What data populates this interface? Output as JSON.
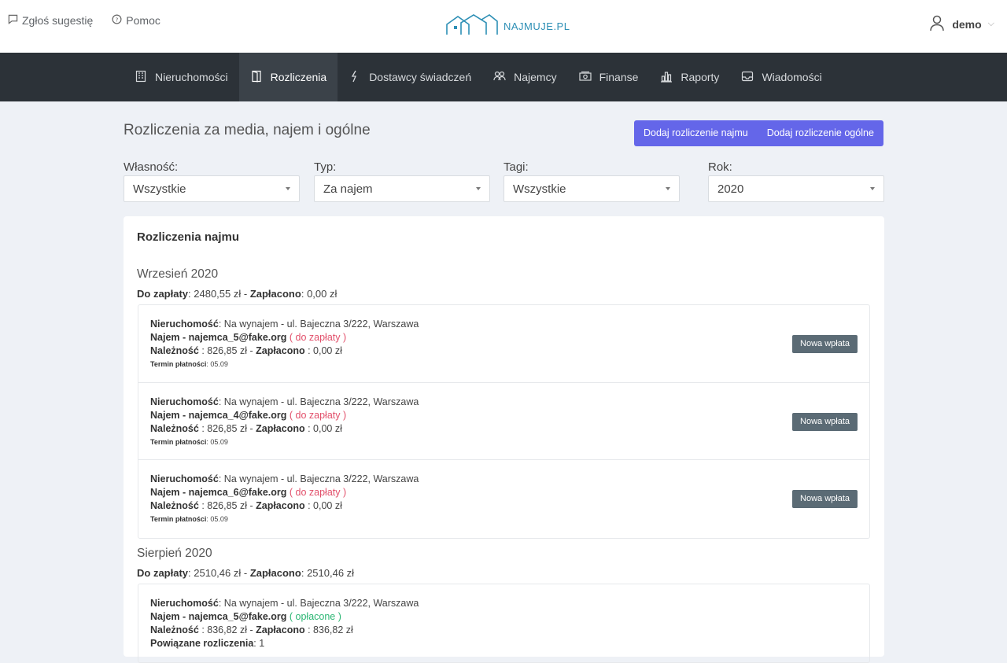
{
  "topbar": {
    "suggest_label": "Zgłoś sugestię",
    "help_label": "Pomoc",
    "logo_text": "NAJMUJE.PL",
    "user_name": "demo"
  },
  "nav": {
    "items": [
      {
        "label": "Nieruchomości",
        "icon": "building-icon"
      },
      {
        "label": "Rozliczenia",
        "icon": "door-icon"
      },
      {
        "label": "Dostawcy świadczeń",
        "icon": "bolt-icon"
      },
      {
        "label": "Najemcy",
        "icon": "users-icon"
      },
      {
        "label": "Finanse",
        "icon": "money-icon"
      },
      {
        "label": "Raporty",
        "icon": "chart-icon"
      },
      {
        "label": "Wiadomości",
        "icon": "inbox-icon"
      }
    ],
    "active": "Rozliczenia"
  },
  "page": {
    "title": "Rozliczenia za media, najem i ogólne",
    "add_rent_label": "Dodaj rozliczenie najmu",
    "add_general_label": "Dodaj rozliczenie ogólne"
  },
  "filters": {
    "ownership": {
      "label": "Własność:",
      "value": "Wszystkie"
    },
    "type": {
      "label": "Typ:",
      "value": "Za najem"
    },
    "tags": {
      "label": "Tagi:",
      "value": "Wszystkie"
    },
    "year": {
      "label": "Rok:",
      "value": "2020"
    }
  },
  "card": {
    "title": "Rozliczenia najmu",
    "labels": {
      "property": "Nieruchomość",
      "rent_prefix": "Najem - ",
      "due": "Należność",
      "paid": "Zapłacono",
      "deadline": "Termin płatności",
      "to_pay": "Do zapłaty",
      "related": "Powiązane rozliczenia",
      "new_payment": "Nowa wpłata"
    },
    "months": [
      {
        "name": "Wrzesień 2020",
        "to_pay": "2480,55 zł",
        "paid": "0,00 zł",
        "items": [
          {
            "property": "Na wynajem - ul. Bajeczna 3/222, Warszawa",
            "tenant": "najemca_5@fake.org",
            "status": "do zapłaty",
            "status_color": "#e2506b",
            "due": "826,85 zł",
            "paid": "0,00 zł",
            "deadline": "05.09"
          },
          {
            "property": "Na wynajem - ul. Bajeczna 3/222, Warszawa",
            "tenant": "najemca_4@fake.org",
            "status": "do zapłaty",
            "status_color": "#e2506b",
            "due": "826,85 zł",
            "paid": "0,00 zł",
            "deadline": "05.09"
          },
          {
            "property": "Na wynajem - ul. Bajeczna 3/222, Warszawa",
            "tenant": "najemca_6@fake.org",
            "status": "do zapłaty",
            "status_color": "#e2506b",
            "due": "826,85 zł",
            "paid": "0,00 zł",
            "deadline": "05.09"
          }
        ]
      },
      {
        "name": "Sierpień 2020",
        "to_pay": "2510,46 zł",
        "paid": "2510,46 zł",
        "items": [
          {
            "property": "Na wynajem - ul. Bajeczna 3/222, Warszawa",
            "tenant": "najemca_5@fake.org",
            "status": "opłacone",
            "status_color": "#2bb673",
            "due": "836,82 zł",
            "paid": "836,82 zł",
            "related": "1"
          }
        ]
      }
    ]
  }
}
